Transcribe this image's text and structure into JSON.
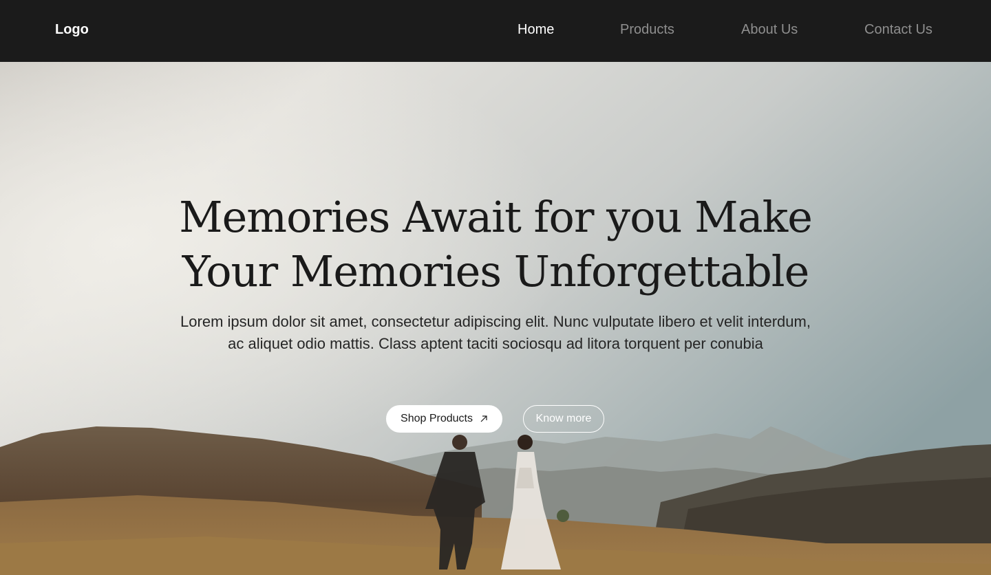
{
  "nav": {
    "logo": "Logo",
    "links": [
      {
        "label": "Home",
        "active": true
      },
      {
        "label": "Products",
        "active": false
      },
      {
        "label": "About Us",
        "active": false
      },
      {
        "label": "Contact Us",
        "active": false
      }
    ]
  },
  "hero": {
    "headline": "Memories Await for you Make Your Memories Unforgettable",
    "subtext": "Lorem ipsum dolor sit amet, consectetur adipiscing elit. Nunc vulputate libero et velit interdum, ac aliquet odio mattis. Class aptent taciti sociosqu ad litora torquent per conubia",
    "primary_button": {
      "label": "Shop Products",
      "icon": "arrow-up-right-icon"
    },
    "secondary_button": {
      "label": "Know more"
    }
  },
  "colors": {
    "nav_background": "#1b1b1b",
    "nav_active": "#ffffff",
    "nav_inactive": "#8f8f8f",
    "headline": "#1a1a1a"
  }
}
